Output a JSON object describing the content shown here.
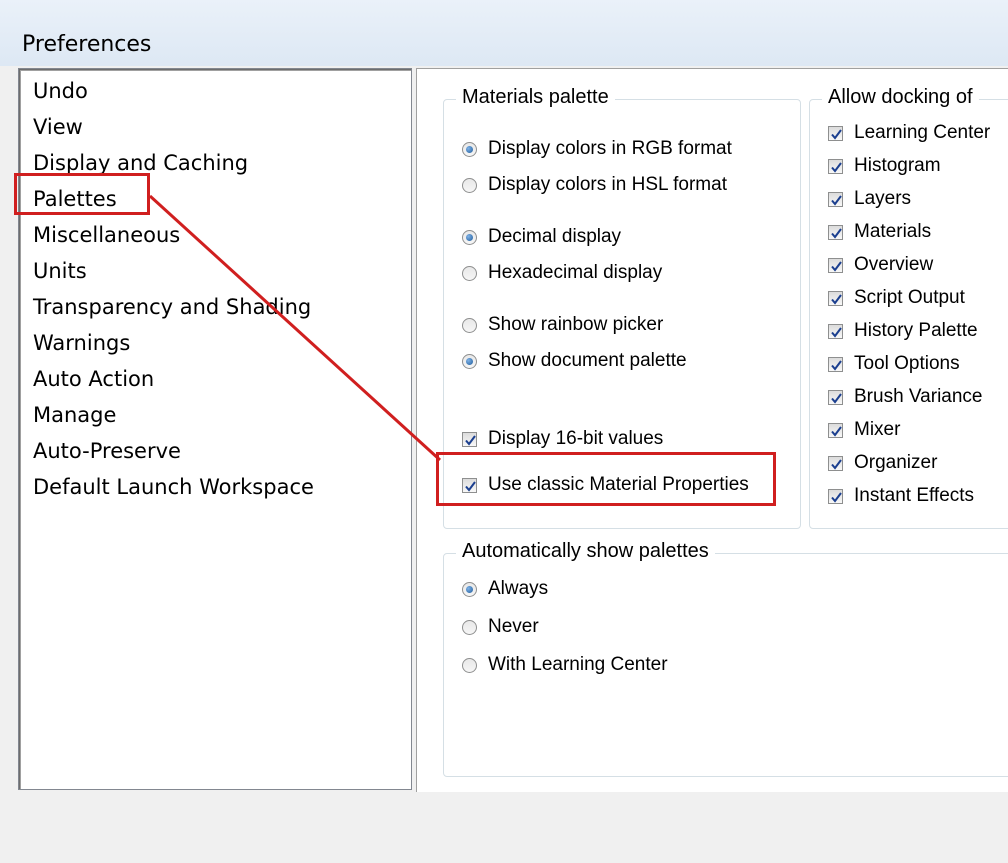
{
  "window": {
    "title": "Preferences"
  },
  "sidebar": {
    "items": [
      {
        "label": "Undo"
      },
      {
        "label": "View"
      },
      {
        "label": "Display and Caching"
      },
      {
        "label": "Palettes"
      },
      {
        "label": "Miscellaneous"
      },
      {
        "label": "Units"
      },
      {
        "label": "Transparency and Shading"
      },
      {
        "label": "Warnings"
      },
      {
        "label": "Auto Action"
      },
      {
        "label": "Manage"
      },
      {
        "label": "Auto-Preserve"
      },
      {
        "label": "Default Launch Workspace"
      }
    ],
    "selected": "Palettes"
  },
  "materials_palette": {
    "legend": "Materials palette",
    "color_format": [
      {
        "label": "Display colors in RGB format",
        "checked": true
      },
      {
        "label": "Display colors in HSL format",
        "checked": false
      }
    ],
    "number_display": [
      {
        "label": "Decimal display",
        "checked": true
      },
      {
        "label": "Hexadecimal display",
        "checked": false
      }
    ],
    "picker": [
      {
        "label": "Show rainbow picker",
        "checked": false
      },
      {
        "label": "Show document palette",
        "checked": true
      }
    ],
    "checkboxes": [
      {
        "label": "Display 16-bit values",
        "checked": true
      },
      {
        "label": "Use classic Material Properties",
        "checked": true
      }
    ]
  },
  "docking": {
    "legend": "Allow docking of",
    "items": [
      {
        "label": "Learning Center",
        "checked": true
      },
      {
        "label": "Histogram",
        "checked": true
      },
      {
        "label": "Layers",
        "checked": true
      },
      {
        "label": "Materials",
        "checked": true
      },
      {
        "label": "Overview",
        "checked": true
      },
      {
        "label": "Script Output",
        "checked": true
      },
      {
        "label": "History Palette",
        "checked": true
      },
      {
        "label": "Tool Options",
        "checked": true
      },
      {
        "label": "Brush Variance",
        "checked": true
      },
      {
        "label": "Mixer",
        "checked": true
      },
      {
        "label": "Organizer",
        "checked": true
      },
      {
        "label": "Instant Effects",
        "checked": true
      }
    ]
  },
  "auto_show": {
    "legend": "Automatically show palettes",
    "options": [
      {
        "label": "Always",
        "checked": true
      },
      {
        "label": "Never",
        "checked": false
      },
      {
        "label": "With Learning Center",
        "checked": false
      }
    ]
  },
  "colors": {
    "highlight": "#d01f1f",
    "radio_selected": "#1f5c9c",
    "check_mark": "#1b3f8f"
  }
}
